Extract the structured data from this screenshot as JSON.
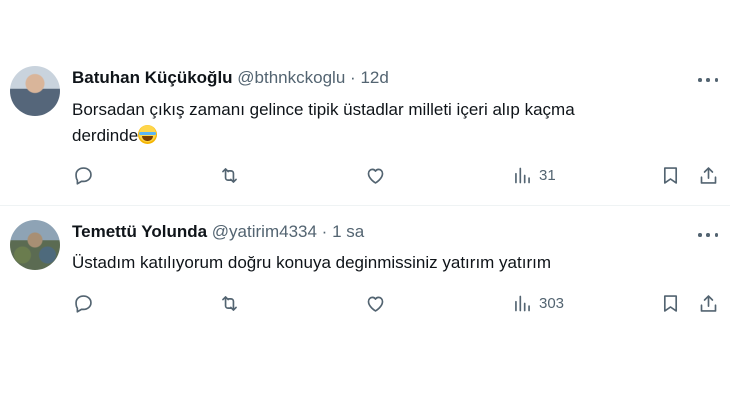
{
  "tweets": [
    {
      "name": "Batuhan Küçükoğlu",
      "handle": "@bthnkckoglu",
      "separator": "·",
      "time": "12d",
      "text_line1": "Borsadan çıkış zamanı gelince tipik üstadlar milleti içeri alıp kaçma",
      "text_line2": "derdinde",
      "emoji": "face-with-tears-of-joy",
      "views": "31"
    },
    {
      "name": "Temettü Yolunda",
      "handle": "@yatirim4334",
      "separator": "·",
      "time": "1 sa",
      "text_line1": "Üstadım katılıyorum doğru konuya deginmissiniz yatırım yatırım",
      "views": "303"
    }
  ],
  "icons": {
    "reply": "reply-icon",
    "retweet": "retweet-icon",
    "like": "heart-icon",
    "views": "views-icon",
    "bookmark": "bookmark-icon",
    "share": "share-icon",
    "more": "more-icon"
  },
  "colors": {
    "text": "#0f1419",
    "secondary": "#536471",
    "divider": "#eff3f4",
    "background": "#ffffff"
  }
}
